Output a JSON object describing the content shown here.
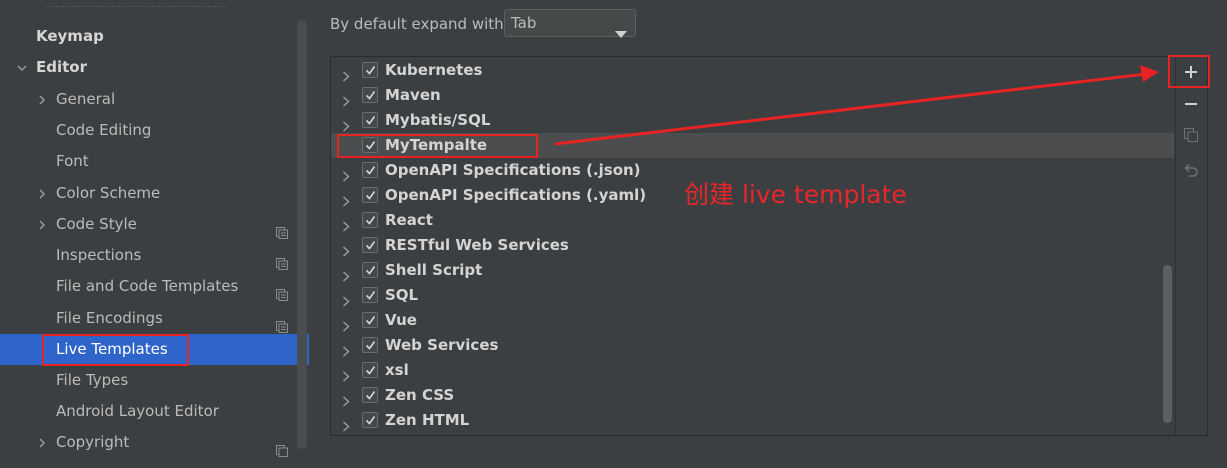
{
  "sidebar": {
    "items": [
      {
        "label": "Keymap",
        "bold": true
      },
      {
        "label": "Editor",
        "bold": true
      },
      {
        "label": "General"
      },
      {
        "label": "Code Editing"
      },
      {
        "label": "Font"
      },
      {
        "label": "Color Scheme"
      },
      {
        "label": "Code Style"
      },
      {
        "label": "Inspections"
      },
      {
        "label": "File and Code Templates"
      },
      {
        "label": "File Encodings"
      },
      {
        "label": "Live Templates",
        "selected": true
      },
      {
        "label": "File Types"
      },
      {
        "label": "Android Layout Editor"
      },
      {
        "label": "Copyright"
      }
    ]
  },
  "expand": {
    "label": "By default expand with",
    "value": "Tab"
  },
  "template_groups": [
    {
      "name": "Kubernetes",
      "checked": true
    },
    {
      "name": "Maven",
      "checked": true
    },
    {
      "name": "Mybatis/SQL",
      "checked": true
    },
    {
      "name": "MyTempalte",
      "checked": true,
      "selected": true
    },
    {
      "name": "OpenAPI Specifications (.json)",
      "checked": true
    },
    {
      "name": "OpenAPI Specifications (.yaml)",
      "checked": true
    },
    {
      "name": "React",
      "checked": true
    },
    {
      "name": "RESTful Web Services",
      "checked": true
    },
    {
      "name": "Shell Script",
      "checked": true
    },
    {
      "name": "SQL",
      "checked": true
    },
    {
      "name": "Vue",
      "checked": true
    },
    {
      "name": "Web Services",
      "checked": true
    },
    {
      "name": "xsl",
      "checked": true
    },
    {
      "name": "Zen CSS",
      "checked": true
    },
    {
      "name": "Zen HTML",
      "checked": true
    }
  ],
  "toolbar": {
    "add": "plus-icon",
    "remove": "minus-icon",
    "copy": "copy-icon",
    "restore": "undo-icon"
  },
  "annotation": {
    "text": "创建 live template",
    "color": "#e8262a"
  },
  "colors": {
    "selection": "#2f65ca",
    "background": "#3c3f41"
  }
}
